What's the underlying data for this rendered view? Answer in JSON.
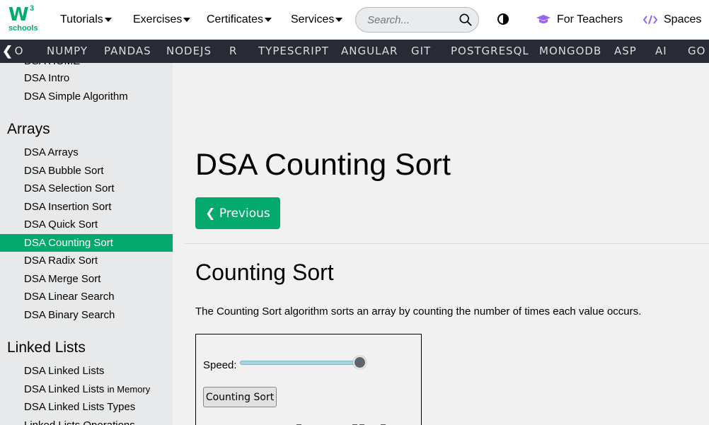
{
  "topnav": {
    "logo_mark": "W",
    "logo_sup": "3",
    "logo_word": "schools",
    "menus": [
      "Tutorials",
      "Exercises",
      "Certificates",
      "Services"
    ],
    "search_placeholder": "Search...",
    "for_teachers": "For Teachers",
    "spaces": "Spaces"
  },
  "subnav": {
    "arrow": "❮",
    "items": [
      "GO",
      "NUMPY",
      "PANDAS",
      "NODEJS",
      "R",
      "TYPESCRIPT",
      "ANGULAR",
      "GIT",
      "POSTGRESQL",
      "MONGODB",
      "ASP",
      "AI",
      "GO"
    ]
  },
  "sidebar": {
    "cut_top": "DSA HOME",
    "group1": [
      "DSA Intro",
      "DSA Simple Algorithm"
    ],
    "heading_arrays": "Arrays",
    "arrays": [
      "DSA Arrays",
      "DSA Bubble Sort",
      "DSA Selection Sort",
      "DSA Insertion Sort",
      "DSA Quick Sort",
      "DSA Counting Sort",
      "DSA Radix Sort",
      "DSA Merge Sort",
      "DSA Linear Search",
      "DSA Binary Search"
    ],
    "active_index": 5,
    "heading_lists": "Linked Lists",
    "lists": [
      "DSA Linked Lists"
    ],
    "ll_memory_main": "DSA Linked Lists",
    "ll_memory_small": "in Memory",
    "ll_types": "DSA Linked Lists Types",
    "ll_ops": "Linked Lists Operations"
  },
  "main": {
    "title": "DSA Counting Sort",
    "prev_label": "❮ Previous",
    "section_title": "Counting Sort",
    "intro": "The Counting Sort algorithm sorts an array by counting the number of times each value occurs.",
    "demo": {
      "speed_label": "Speed:",
      "speed_value": 1.0,
      "sort_button": "Counting Sort"
    }
  },
  "colors": {
    "brand": "#04aa6d",
    "subnav_bg": "#282a35",
    "sidebar_bg": "#e7e9eb"
  }
}
